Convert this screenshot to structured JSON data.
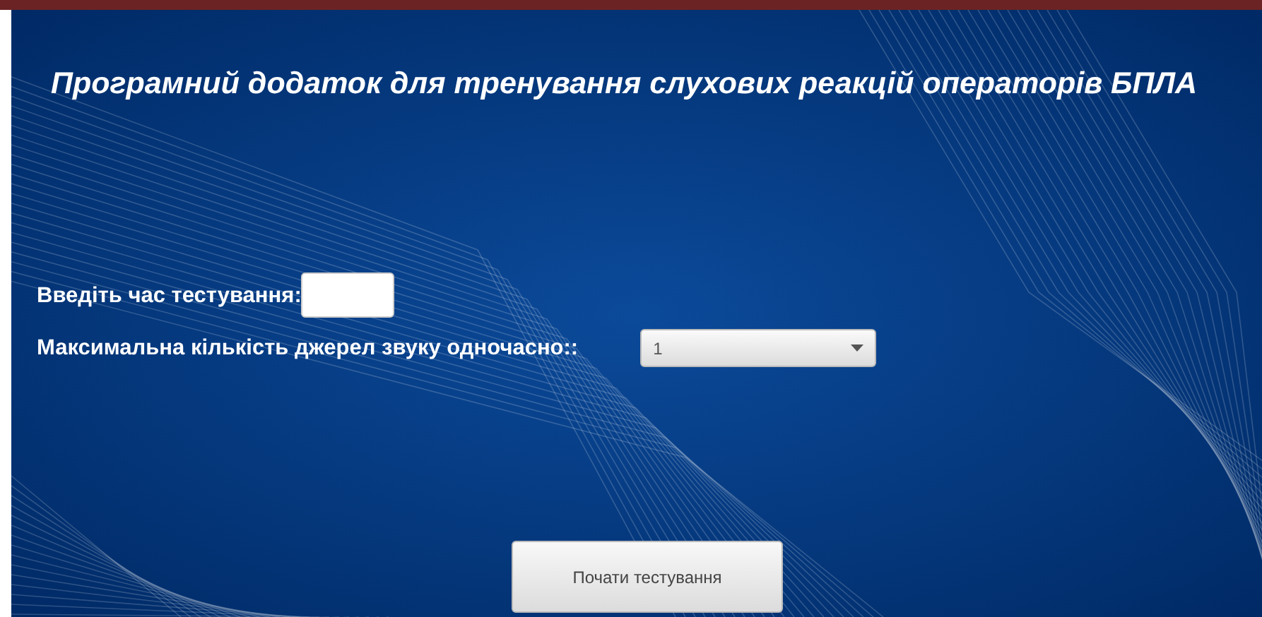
{
  "title": "Програмний додаток для тренування слухових реакцій операторів БПЛА",
  "fields": [
    {
      "kind": "text",
      "label": "Введіть час тестування:"
    },
    {
      "kind": "select",
      "label": "Максимальна кількість джерел звуку одночасно::",
      "value": "1"
    }
  ],
  "button": "Почати тестування"
}
